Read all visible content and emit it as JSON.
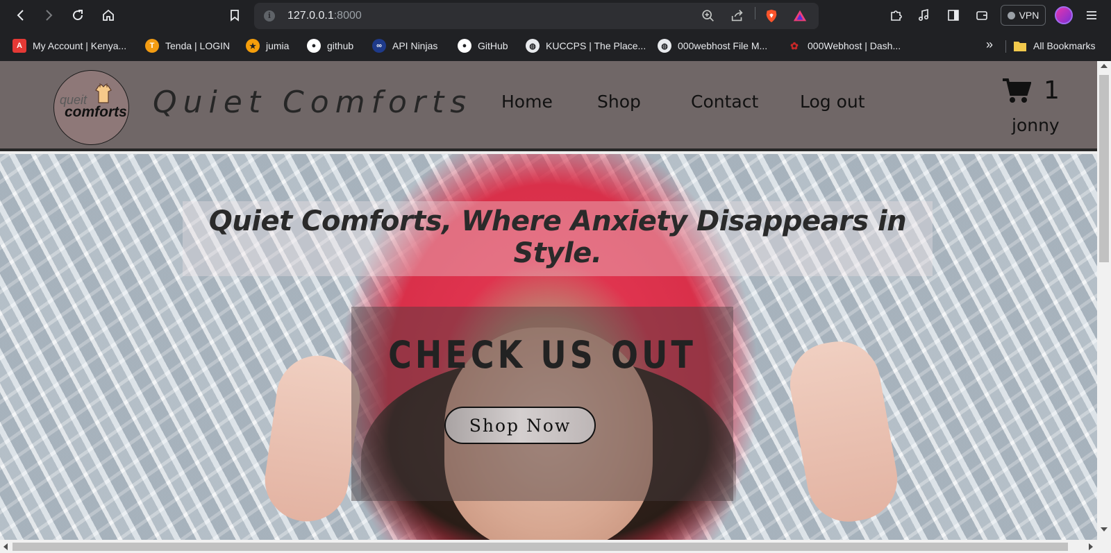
{
  "browser": {
    "url_host": "127.0.0.1",
    "url_port": ":8000",
    "vpn_label": "VPN",
    "bookmarks": [
      {
        "label": "My Account | Kenya...",
        "icon": "app-a-icon",
        "color": "#e53935"
      },
      {
        "label": "Tenda | LOGIN",
        "icon": "tenda-icon",
        "color": "#f39c12"
      },
      {
        "label": "jumia",
        "icon": "star-icon",
        "color": "#f59e0b"
      },
      {
        "label": "github",
        "icon": "github-icon",
        "color": "#ffffff"
      },
      {
        "label": "API Ninjas",
        "icon": "ninja-icon",
        "color": "#1e3a8a"
      },
      {
        "label": "GitHub",
        "icon": "github-icon",
        "color": "#ffffff"
      },
      {
        "label": "KUCCPS | The Place...",
        "icon": "globe-icon",
        "color": "#e8eaed"
      },
      {
        "label": "000webhost File M...",
        "icon": "globe-icon",
        "color": "#e8eaed"
      },
      {
        "label": "000Webhost | Dash...",
        "icon": "webhost-icon",
        "color": "#c62828"
      }
    ],
    "more_label": "»",
    "all_bookmarks": "All Bookmarks"
  },
  "site": {
    "logo_line1": "queit",
    "logo_line2": "comforts",
    "title": "Quiet Comforts",
    "nav": [
      "Home",
      "Shop",
      "Contact",
      "Log out"
    ],
    "cart_count": "1",
    "username": "jonny",
    "header_color": "#706767"
  },
  "hero": {
    "tagline": "Quiet Comforts, Where Anxiety Disappears in Style.",
    "cta_title": "CHECK US OUT",
    "cta_button": "Shop Now"
  }
}
